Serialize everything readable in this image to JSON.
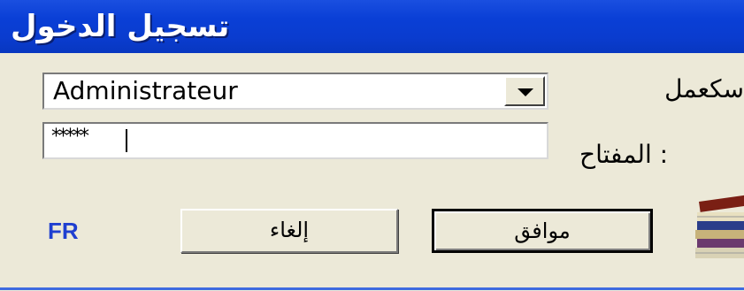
{
  "window": {
    "title": "تسجيل الدخول"
  },
  "form": {
    "username_value": "Administrateur",
    "username_label": "سكعمل",
    "password_value": "*****",
    "password_label": ": المفتاح"
  },
  "buttons": {
    "language": "FR",
    "cancel": "إلغاء",
    "ok": "موافق"
  },
  "icons": {
    "dropdown": "chevron-down-icon",
    "app": "books-icon"
  }
}
